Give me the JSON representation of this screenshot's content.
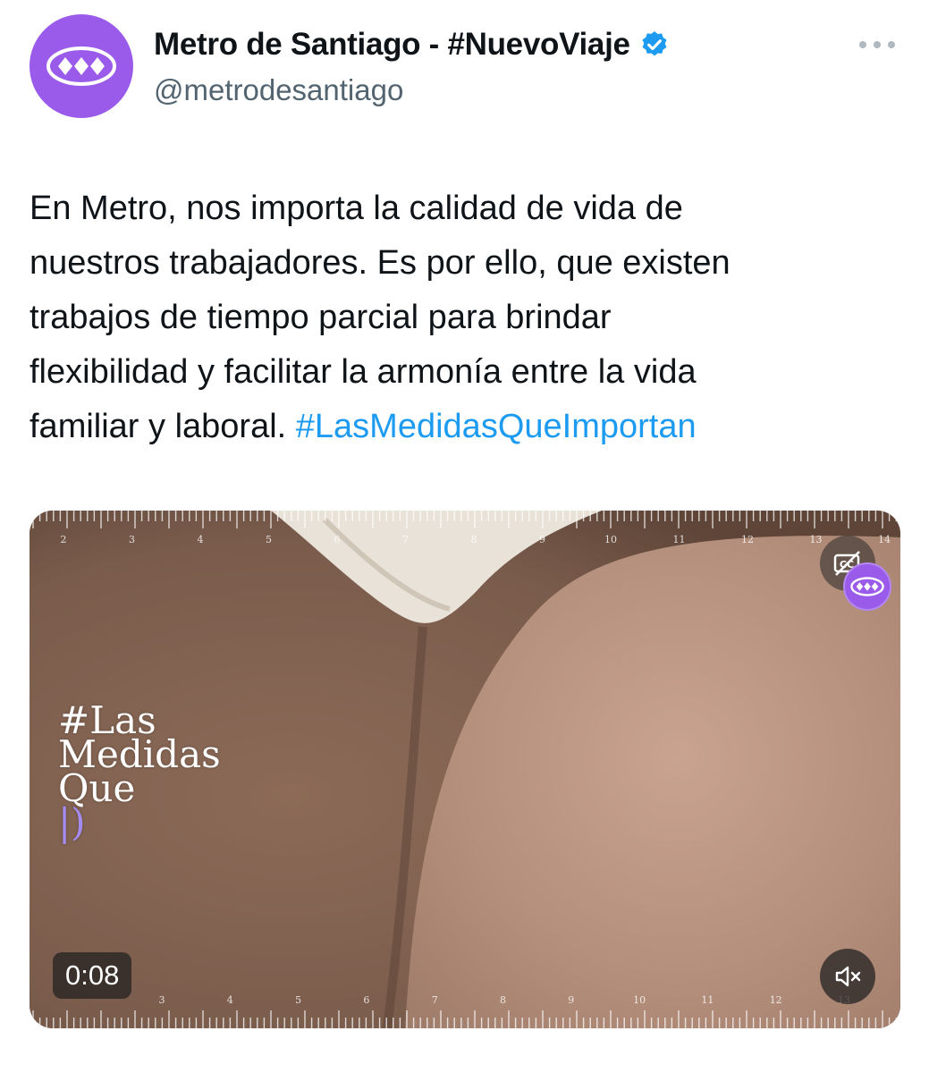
{
  "tweet": {
    "author": {
      "display_name": "Metro de Santiago - #NuevoViaje",
      "handle": "@metrodesantiago",
      "verified": true,
      "avatar_icon": "metro-logo-icon",
      "avatar_color": "#9b5bea"
    },
    "more_icon": "more-dots-icon",
    "text_lines": [
      "En Metro, nos importa la calidad de vida de",
      "nuestros trabajadores. Es por ello, que existen",
      "trabajos de tiempo parcial para brindar",
      "flexibilidad y facilitar la armonía entre la vida",
      "familiar y laboral."
    ],
    "hashtag": "#LasMedidasQueImportan",
    "hashtag_color": "#1d9bf0"
  },
  "media": {
    "type": "video",
    "overlay_text_lines": [
      "#Las",
      "Medidas",
      "Que"
    ],
    "overlay_cursor": "|)",
    "timestamp": "0:08",
    "ruler_top_numbers": [
      "2",
      "3",
      "4",
      "5",
      "6",
      "7",
      "8",
      "9",
      "10",
      "11",
      "12",
      "13",
      "14"
    ],
    "ruler_bottom_numbers": [
      "3",
      "4",
      "5",
      "6",
      "7",
      "8",
      "9",
      "10",
      "11",
      "12",
      "13"
    ],
    "cc_icon": "captions-off-icon",
    "mute_icon": "volume-muted-icon",
    "badge_icon": "metro-logo-icon"
  }
}
